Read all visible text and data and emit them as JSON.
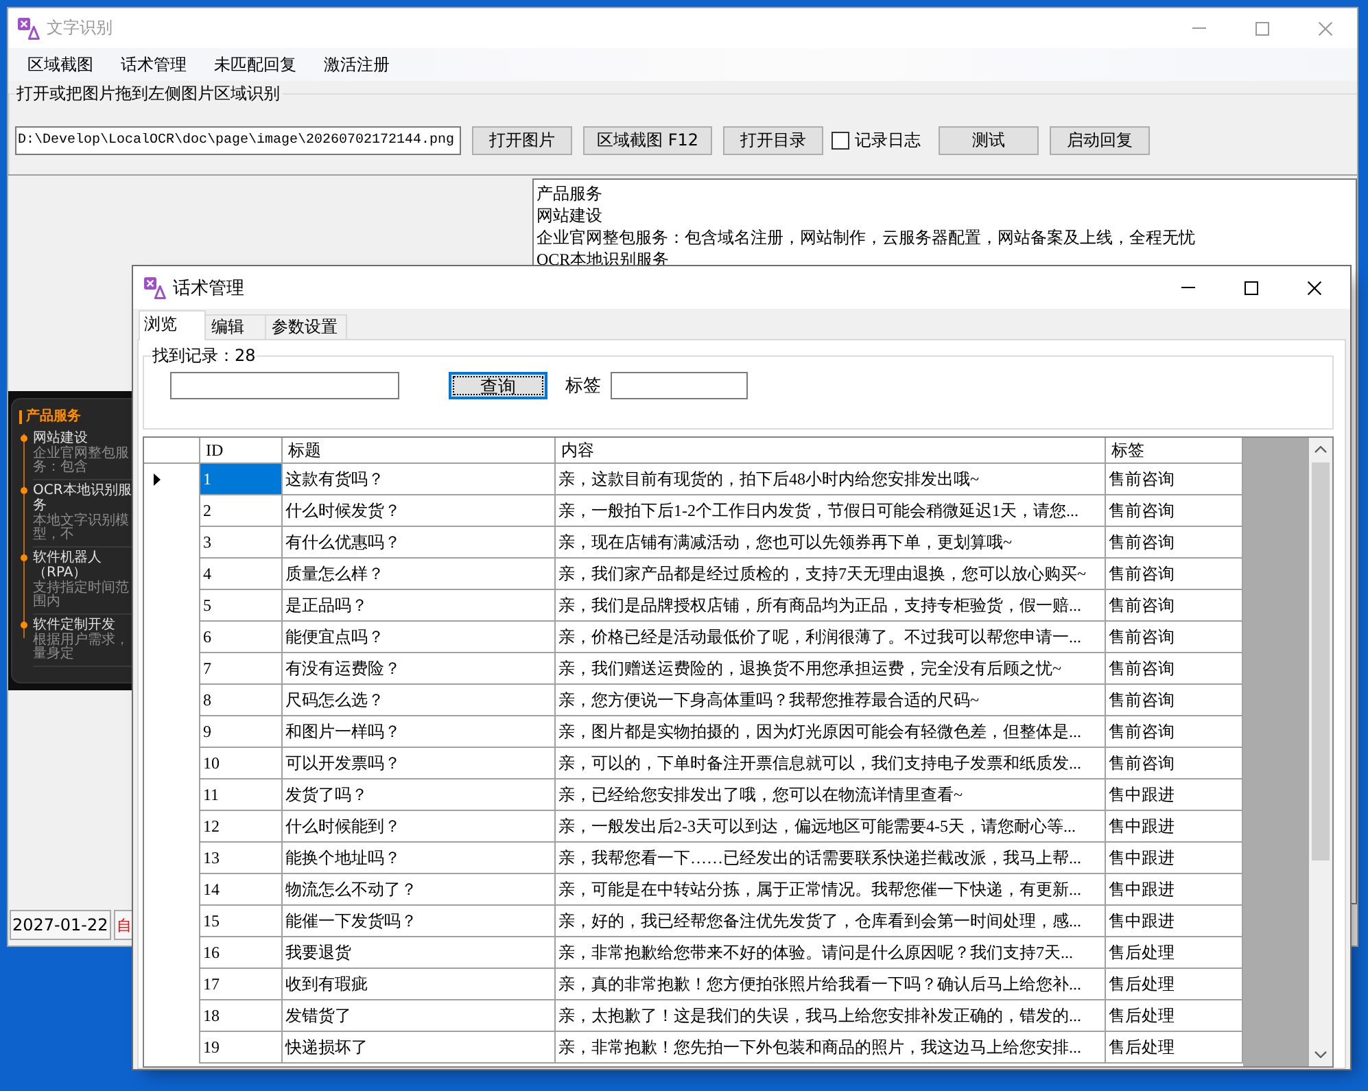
{
  "main_window": {
    "title": "文字识别",
    "active": false,
    "menu": [
      {
        "label": "区域截图"
      },
      {
        "label": "话术管理"
      },
      {
        "label": "未匹配回复"
      },
      {
        "label": "激活注册"
      }
    ],
    "group_label": "打开或把图片拖到左侧图片区域识别",
    "toolbar": [
      {
        "kind": "field",
        "value": "D:\\Develop\\LocalOCR\\doc\\page\\image\\20260702172144.png"
      },
      {
        "kind": "button",
        "label": "打开图片"
      },
      {
        "kind": "button",
        "label": "区域截图 F12"
      },
      {
        "kind": "button",
        "label": "打开目录"
      },
      {
        "kind": "checkbox",
        "label": "记录日志",
        "checked": false
      },
      {
        "kind": "button",
        "label": "测试"
      },
      {
        "kind": "button",
        "label": "启动回复"
      }
    ],
    "image_preview": {
      "heading": "产品服务",
      "items": [
        {
          "title": "网站建设",
          "subtitle": "企业官网整包服务：包含"
        },
        {
          "title": "OCR本地识别服务",
          "subtitle": "本地文字识别模型，不"
        },
        {
          "title": "软件机器人（RPA）",
          "subtitle": "支持指定时间范围内"
        },
        {
          "title": "软件定制开发",
          "subtitle": "根据用户需求，量身定"
        }
      ]
    },
    "ocr_text": [
      "产品服务",
      "网站建设",
      "企业官网整包服务：包含域名注册，网站制作，云服务器配置，网站备案及上线，全程无忧",
      "OCR本地识别服务"
    ],
    "status_bar": [
      {
        "text": "2027-01-22",
        "color": "#000000"
      },
      {
        "text": "自",
        "color": "#ff0000"
      }
    ]
  },
  "dialog": {
    "title": "话术管理",
    "active": true,
    "tabs": [
      {
        "label": "浏览",
        "selected": true
      },
      {
        "label": "编辑",
        "selected": false
      },
      {
        "label": "参数设置",
        "selected": false
      }
    ],
    "group_title": "找到记录：28",
    "query_button": {
      "label": "查询",
      "focused": true
    },
    "tag_label": "标签",
    "table": {
      "columns": [
        "ID",
        "标题",
        "内容",
        "标签"
      ],
      "rows": [
        {
          "cells": [
            "1",
            "这款有货吗？",
            "亲，这款目前有现货的，拍下后48小时内给您安排发出哦~",
            "售前咨询"
          ],
          "selected": true
        },
        {
          "cells": [
            "2",
            "什么时候发货？",
            "亲，一般拍下后1-2个工作日内发货，节假日可能会稍微延迟1天，请您...",
            "售前咨询"
          ],
          "selected": false
        },
        {
          "cells": [
            "3",
            "有什么优惠吗？",
            "亲，现在店铺有满减活动，您也可以先领券再下单，更划算哦~",
            "售前咨询"
          ],
          "selected": false
        },
        {
          "cells": [
            "4",
            "质量怎么样？",
            "亲，我们家产品都是经过质检的，支持7天无理由退换，您可以放心购买~",
            "售前咨询"
          ],
          "selected": false
        },
        {
          "cells": [
            "5",
            "是正品吗？",
            "亲，我们是品牌授权店铺，所有商品均为正品，支持专柜验货，假一赔...",
            "售前咨询"
          ],
          "selected": false
        },
        {
          "cells": [
            "6",
            "能便宜点吗？",
            "亲，价格已经是活动最低价了呢，利润很薄了。不过我可以帮您申请一...",
            "售前咨询"
          ],
          "selected": false
        },
        {
          "cells": [
            "7",
            "有没有运费险？",
            "亲，我们赠送运费险的，退换货不用您承担运费，完全没有后顾之忧~",
            "售前咨询"
          ],
          "selected": false
        },
        {
          "cells": [
            "8",
            "尺码怎么选？",
            "亲，您方便说一下身高体重吗？我帮您推荐最合适的尺码~",
            "售前咨询"
          ],
          "selected": false
        },
        {
          "cells": [
            "9",
            "和图片一样吗？",
            "亲，图片都是实物拍摄的，因为灯光原因可能会有轻微色差，但整体是...",
            "售前咨询"
          ],
          "selected": false
        },
        {
          "cells": [
            "10",
            "可以开发票吗？",
            "亲，可以的，下单时备注开票信息就可以，我们支持电子发票和纸质发...",
            "售前咨询"
          ],
          "selected": false
        },
        {
          "cells": [
            "11",
            "发货了吗？",
            "亲，已经给您安排发出了哦，您可以在物流详情里查看~",
            "售中跟进"
          ],
          "selected": false
        },
        {
          "cells": [
            "12",
            "什么时候能到？",
            "亲，一般发出后2-3天可以到达，偏远地区可能需要4-5天，请您耐心等...",
            "售中跟进"
          ],
          "selected": false
        },
        {
          "cells": [
            "13",
            "能换个地址吗？",
            "亲，我帮您看一下……已经发出的话需要联系快递拦截改派，我马上帮...",
            "售中跟进"
          ],
          "selected": false
        },
        {
          "cells": [
            "14",
            "物流怎么不动了？",
            "亲，可能是在中转站分拣，属于正常情况。我帮您催一下快递，有更新...",
            "售中跟进"
          ],
          "selected": false
        },
        {
          "cells": [
            "15",
            "能催一下发货吗？",
            "亲，好的，我已经帮您备注优先发货了，仓库看到会第一时间处理，感...",
            "售中跟进"
          ],
          "selected": false
        },
        {
          "cells": [
            "16",
            "我要退货",
            "亲，非常抱歉给您带来不好的体验。请问是什么原因呢？我们支持7天...",
            "售后处理"
          ],
          "selected": false
        },
        {
          "cells": [
            "17",
            "收到有瑕疵",
            "亲，真的非常抱歉！您方便拍张照片给我看一下吗？确认后马上给您补...",
            "售后处理"
          ],
          "selected": false
        },
        {
          "cells": [
            "18",
            "发错货了",
            "亲，太抱歉了！这是我们的失误，我马上给您安排补发正确的，错发的...",
            "售后处理"
          ],
          "selected": false
        },
        {
          "cells": [
            "19",
            "快递损坏了",
            "亲，非常抱歉！您先拍一下外包装和商品的照片，我这边马上给您安排...",
            "售后处理"
          ],
          "selected": false
        }
      ]
    }
  }
}
